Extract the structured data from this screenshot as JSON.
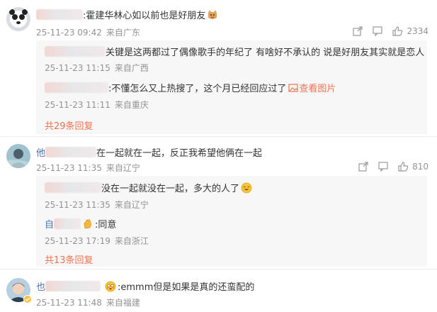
{
  "comments": [
    {
      "text": ":霍建华林心如以前也是好朋友",
      "time": "25-11-23 09:42",
      "location": "来自广东",
      "likes": "2334",
      "replies": [
        {
          "text": "关键是这两都过了偶像歌手的年纪了 有啥好不承认的 说是好朋友其实就是恋人",
          "time": "25-11-23 11:15",
          "location": "来自广西"
        },
        {
          "text": ":不懂怎么又上热搜了，这个月已经回应过了",
          "link": "查看图片",
          "time": "25-11-23 11:11",
          "location": "来自重庆"
        }
      ],
      "more": "共29条回复"
    },
    {
      "name_first": "他",
      "text": "在一起就在一起，反正我希望他俩在一起",
      "time": "25-11-23 11:35",
      "location": "来自辽宁",
      "likes": "810",
      "replies": [
        {
          "text": "没在一起就没在一起，多大的人了",
          "time": "25-11-23 11:35",
          "location": "来自辽宁"
        },
        {
          "name_first": "自",
          "text": ":同意",
          "time": "25-11-23 17:19",
          "location": "来自浙江"
        }
      ],
      "more": "共13条回复"
    },
    {
      "name_first": "也",
      "text": ":emmm但是如果是真的还蛮配的",
      "time": "25-11-23 11:48",
      "location": "来自福建"
    }
  ],
  "icons": [
    "share-icon",
    "comment-icon",
    "like-icon",
    "smile-emoji-icon",
    "clap-emoji-icon",
    "image-link-icon",
    "verified-badge-icon"
  ],
  "colors": {
    "accent": "#eb7350",
    "name": "#4a74a8",
    "meta": "#939393",
    "reply_bg": "#f7f7f7"
  }
}
